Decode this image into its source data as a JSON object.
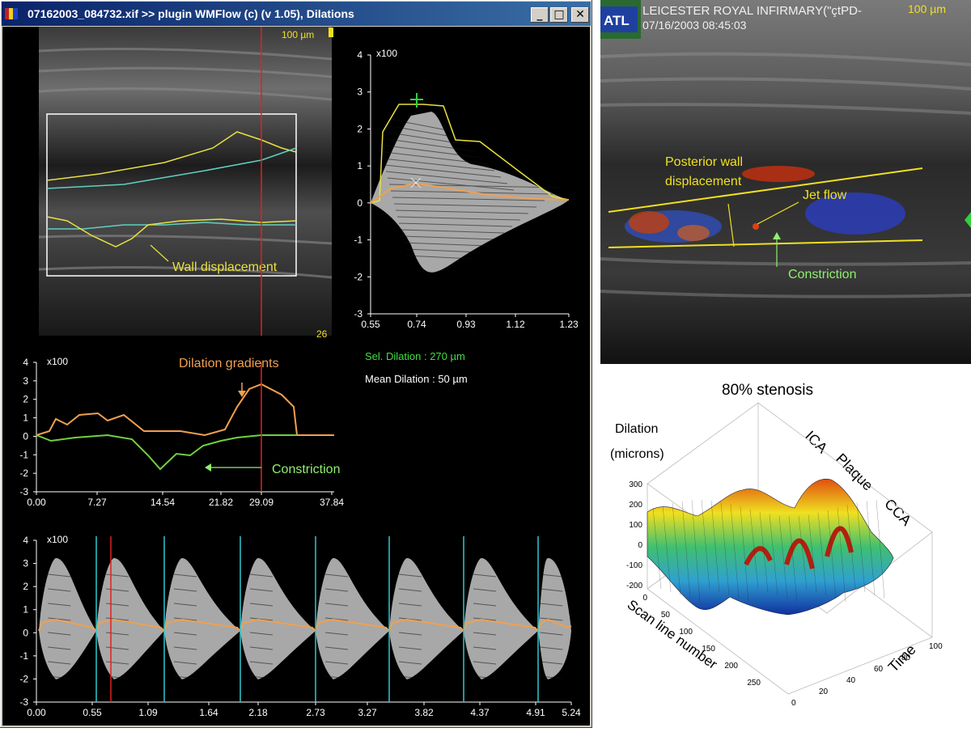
{
  "window": {
    "title": "07162003_084732.xif >> plugin WMFlow (c) (v 1.05), Dilations",
    "buttons": {
      "minimize": "_",
      "maximize": "□",
      "close": "✕"
    }
  },
  "bmode": {
    "scale_label": "100 µm",
    "frame_number": "26",
    "annotation": "Wall displacement"
  },
  "dilation_profile": {
    "multiplier": "x100",
    "y_ticks": [
      "4",
      "3",
      "2",
      "1",
      "0",
      "-1",
      "-2",
      "-3"
    ],
    "x_ticks": [
      "0.55",
      "0.74",
      "0.93",
      "1.12",
      "1.23"
    ],
    "sel_dilation": "Sel. Dilation : 270 µm",
    "mean_dilation": "Mean Dilation : 50 µm"
  },
  "gradients": {
    "multiplier": "x100",
    "y_ticks": [
      "4",
      "3",
      "2",
      "1",
      "0",
      "-1",
      "-2",
      "-3"
    ],
    "x_ticks": [
      "0.00",
      "7.27",
      "14.54",
      "21.82",
      "29.09",
      "37.84"
    ],
    "label_dilation": "Dilation gradients",
    "label_constriction": "Constriction"
  },
  "timeline": {
    "multiplier": "x100",
    "y_ticks": [
      "4",
      "3",
      "2",
      "1",
      "0",
      "-1",
      "-2",
      "-3"
    ],
    "x_ticks": [
      "0.00",
      "0.55",
      "1.09",
      "1.64",
      "2.18",
      "2.73",
      "3.27",
      "3.82",
      "4.37",
      "4.91",
      "5.24"
    ]
  },
  "doppler": {
    "logo": "ATL",
    "hospital": "LEICESTER ROYAL INFIRMARY(\"çtPD-",
    "datetime": "07/16/2003 08:45:03",
    "scale": "100 µm",
    "label_posterior_line1": "Posterior wall",
    "label_posterior_line2": "displacement",
    "label_jet": "Jet flow",
    "label_constriction": "Constriction"
  },
  "surface_plot": {
    "title": "80% stenosis",
    "z_label_line1": "Dilation",
    "z_label_line2": "(microns)",
    "region_labels": [
      "ICA",
      "Plaque",
      "CCA"
    ],
    "z_ticks": [
      "300",
      "200",
      "100",
      "0",
      "-100",
      "-200"
    ],
    "x_label": "Scan line number",
    "x_ticks": [
      "0",
      "50",
      "100",
      "150",
      "200",
      "250"
    ],
    "y_label": "Time",
    "y_ticks": [
      "0",
      "20",
      "40",
      "60",
      "80",
      "100"
    ]
  },
  "colors": {
    "yellow": "#e8e040",
    "orange": "#f0a050",
    "green": "#80e050",
    "cyan": "#30c8d0",
    "red_marker": "#e02020",
    "trace_gray": "#a8a8a8"
  }
}
